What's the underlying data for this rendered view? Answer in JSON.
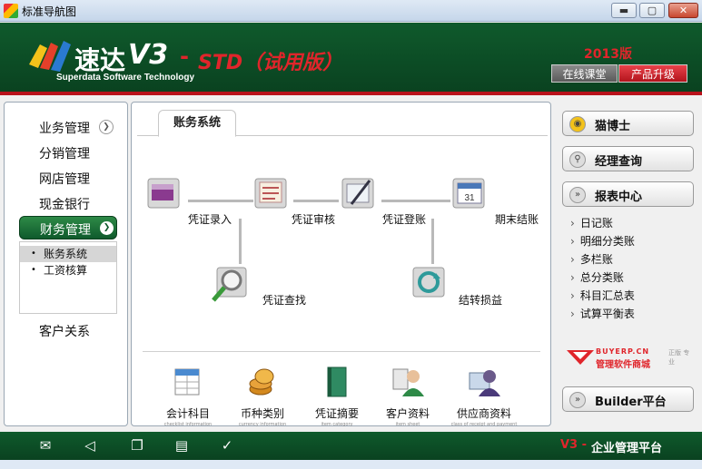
{
  "window": {
    "title": "标准导航图",
    "minimize": "▬",
    "maximize": "▢",
    "close": "✕"
  },
  "header": {
    "logo_name": "速达",
    "logo_version": "V3",
    "logo_dash": "-",
    "logo_edition": "STD（试用版）",
    "logo_sub": "Superdata Software Technology",
    "year": "2013版",
    "online_class": "在线课堂",
    "upgrade": "产品升级"
  },
  "sidebar": {
    "items": [
      {
        "label": "业务管理"
      },
      {
        "label": "分销管理"
      },
      {
        "label": "网店管理"
      },
      {
        "label": "现金银行"
      },
      {
        "label": "财务管理"
      },
      {
        "label": "客户关系"
      }
    ],
    "sub_items": [
      {
        "label": "账务系统"
      },
      {
        "label": "工资核算"
      }
    ]
  },
  "main": {
    "tab": "账务系统",
    "flow": [
      {
        "label": "凭证录入"
      },
      {
        "label": "凭证审核"
      },
      {
        "label": "凭证登账"
      },
      {
        "label": "期末结账"
      },
      {
        "label": "凭证查找"
      },
      {
        "label": "结转损益"
      }
    ],
    "calendar_day": "31",
    "bottom": [
      {
        "label": "会计科目",
        "sub": "checklist information"
      },
      {
        "label": "币种类别",
        "sub": "currency information"
      },
      {
        "label": "凭证摘要",
        "sub": "item category"
      },
      {
        "label": "客户资料",
        "sub": "item sheet"
      },
      {
        "label": "供应商资料",
        "sub": "class of receipt and payment"
      }
    ]
  },
  "right": {
    "doctor": "猫博士",
    "manager_query": "经理查询",
    "report_center": "报表中心",
    "reports": [
      {
        "label": "日记账"
      },
      {
        "label": "明细分类账"
      },
      {
        "label": "多栏账"
      },
      {
        "label": "总分类账"
      },
      {
        "label": "科目汇总表"
      },
      {
        "label": "试算平衡表"
      }
    ],
    "shop_top": "BUYERP.CN",
    "shop_name": "管理软件商城",
    "shop_tag": "正版 专业",
    "builder": "Builder平台"
  },
  "footer": {
    "brand": "V3 -",
    "platform": "企业管理平台"
  },
  "colors": {
    "brand_green": "#0f5a2c",
    "brand_red": "#e0252b"
  }
}
